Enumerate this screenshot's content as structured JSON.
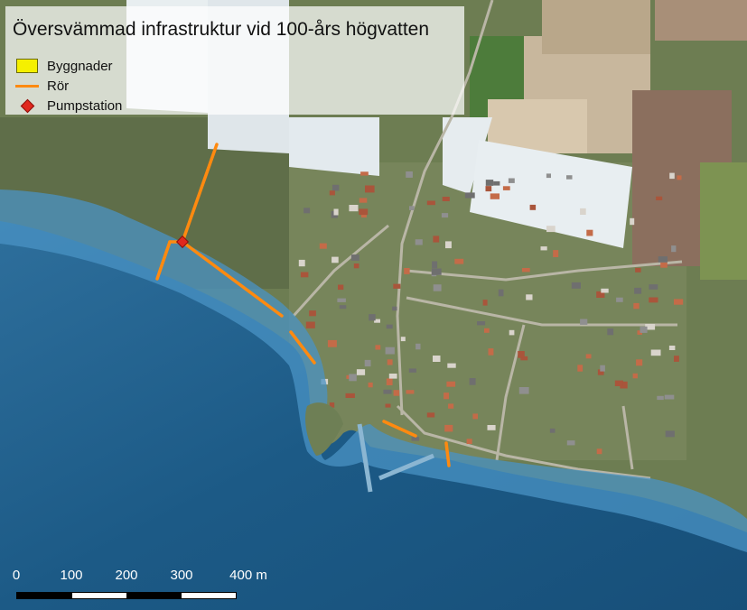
{
  "map": {
    "title": "Översvämmad infrastruktur vid 100-års högvatten",
    "legend": [
      {
        "label": "Byggnader",
        "symbol": "yellow-square",
        "color": "#f5f000"
      },
      {
        "label": "Rör",
        "symbol": "orange-line",
        "color": "#ff8a10"
      },
      {
        "label": "Pumpstation",
        "symbol": "red-diamond",
        "color": "#e0281e"
      }
    ],
    "scale_bar": {
      "labels": [
        "0",
        "100",
        "200",
        "300",
        "400 m"
      ]
    },
    "colors": {
      "sea": "#1b5b86",
      "flood": "#4a93c4",
      "pipe": "#ff8a10",
      "pump": "#e0281e",
      "building": "#f5f000"
    }
  }
}
